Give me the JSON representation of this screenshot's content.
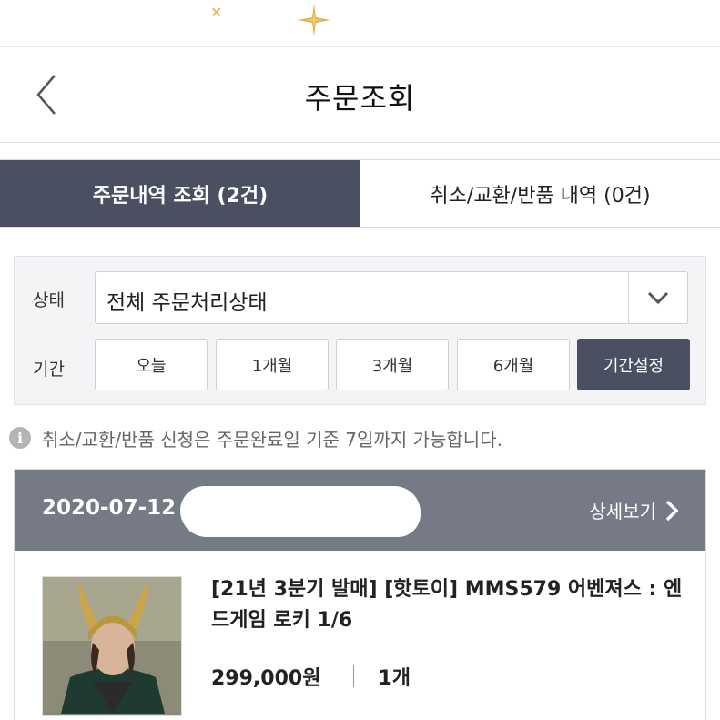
{
  "header": {
    "title": "주문조회"
  },
  "tabs": [
    {
      "label": "주문내역 조회 (2건)",
      "active": true
    },
    {
      "label": "취소/교환/반품 내역 (0건)",
      "active": false
    }
  ],
  "filter": {
    "status_label": "상태",
    "status_value": "전체 주문처리상태",
    "period_label": "기간",
    "period_options": [
      "오늘",
      "1개월",
      "3개월",
      "6개월",
      "기간설정"
    ],
    "selected_period": "기간설정"
  },
  "notice": {
    "text": "취소/교환/반품 신청은 주문완료일 기준 7일까지 가능합니다."
  },
  "order": {
    "date": "2020-07-12",
    "detail_label": "상세보기",
    "product_name": "[21년 3분기 발매] [핫토이] MMS579 어벤져스 : 엔드게임 로키 1/6",
    "price": "299,000원",
    "quantity": "1개"
  },
  "colors": {
    "active_tab_bg": "#4a5061",
    "order_header_bg": "#767a86",
    "filter_bg": "#f4f4f6",
    "banner_star": "#e0b14a"
  }
}
